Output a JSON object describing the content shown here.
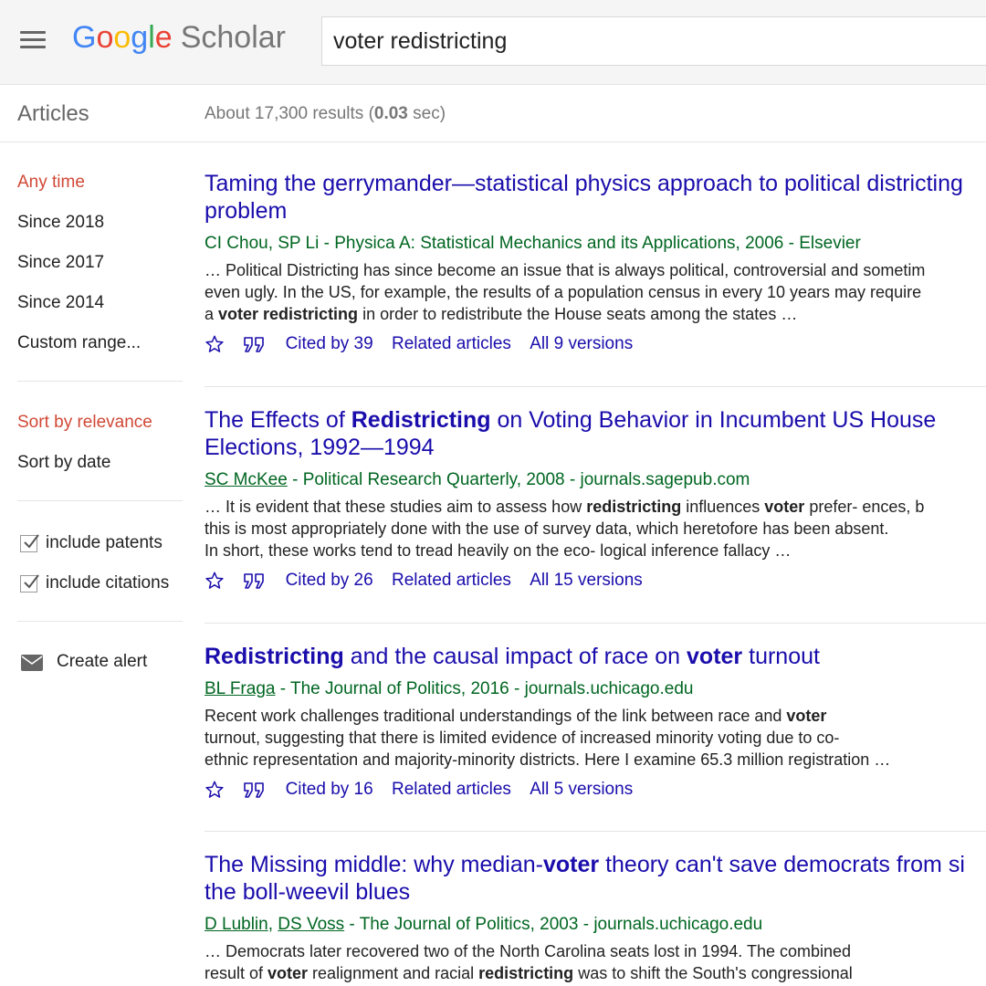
{
  "header": {
    "logo": {
      "g1": "G",
      "o1": "o",
      "o2": "o",
      "g2": "g",
      "l": "l",
      "e": "e",
      "product": "Scholar"
    },
    "search_value": "voter redistricting"
  },
  "subbar": {
    "section": "Articles",
    "stats_prefix": "About 17,300 results (",
    "stats_time": "0.03",
    "stats_suffix": " sec)"
  },
  "sidebar": {
    "time_filters": [
      "Any time",
      "Since 2018",
      "Since 2017",
      "Since 2014",
      "Custom range..."
    ],
    "sort_options": [
      "Sort by relevance",
      "Sort by date"
    ],
    "checkboxes": [
      {
        "label": "include patents",
        "checked": true
      },
      {
        "label": "include citations",
        "checked": true
      }
    ],
    "alert": "Create alert"
  },
  "results": [
    {
      "title_line1": "Taming the gerrymander—statistical physics approach to political districting",
      "title_line2": "problem",
      "authors": "CI Chou, SP Li",
      "meta": " - Physica A: Statistical Mechanics and its Applications, 2006 - Elsevier",
      "snippet": [
        "… Political Districting has since become an issue that is always political, controversial and sometim",
        "even ugly. In the US, for example, the results of a population census in every 10 years may require",
        [
          "a ",
          {
            "b": "voter redistricting"
          },
          " in order to redistribute the House seats among the states …"
        ]
      ],
      "cited": "Cited by 39",
      "related": "Related articles",
      "versions": "All 9 versions"
    },
    {
      "title_line1": [
        "The Effects of ",
        {
          "b": "Redistricting"
        },
        " on Voting Behavior in Incumbent US House"
      ],
      "title_line2": "Elections, 1992—1994",
      "authors": "SC McKee",
      "meta": " - Political Research Quarterly, 2008 - journals.sagepub.com",
      "snippet": [
        [
          "… It is evident that these studies aim to assess how ",
          {
            "b": "redistricting"
          },
          " influences ",
          {
            "b": "voter"
          },
          " prefer- ences, b"
        ],
        "this is most appropriately done with the use of survey data, which heretofore has been absent.",
        "In short, these works tend to tread heavily on the eco- logical inference fallacy …"
      ],
      "cited": "Cited by 26",
      "related": "Related articles",
      "versions": "All 15 versions"
    },
    {
      "title_line1": [
        {
          "b": "Redistricting"
        },
        " and the causal impact of race on ",
        {
          "b": "voter"
        },
        " turnout"
      ],
      "title_line2": "",
      "authors": "BL Fraga",
      "meta": " - The Journal of Politics, 2016 - journals.uchicago.edu",
      "snippet": [
        [
          "Recent work challenges traditional understandings of the link between race and ",
          {
            "b": "voter"
          }
        ],
        "turnout, suggesting that there is limited evidence of increased minority voting due to co-",
        "ethnic representation and majority-minority districts. Here I examine 65.3 million registration …"
      ],
      "cited": "Cited by 16",
      "related": "Related articles",
      "versions": "All 5 versions"
    },
    {
      "title_line1": [
        "The Missing middle: why median-",
        {
          "b": "voter"
        },
        " theory can't save democrats from si"
      ],
      "title_line2": "the boll-weevil blues",
      "authors": "D Lublin, DS Voss",
      "meta": " - The Journal of Politics, 2003 - journals.uchicago.edu",
      "snippet": [
        "… Democrats later recovered two of the North Carolina seats lost in 1994. The combined",
        [
          "result of ",
          {
            "b": "voter"
          },
          " realignment and racial ",
          {
            "b": "redistricting"
          },
          " was to shift the South's congressional"
        ]
      ],
      "cited": "",
      "related": "",
      "versions": ""
    }
  ],
  "colors": {
    "link": "#1a0dab",
    "meta_green": "#006621",
    "active_red": "#d14836",
    "header_bg": "#f5f5f5"
  }
}
